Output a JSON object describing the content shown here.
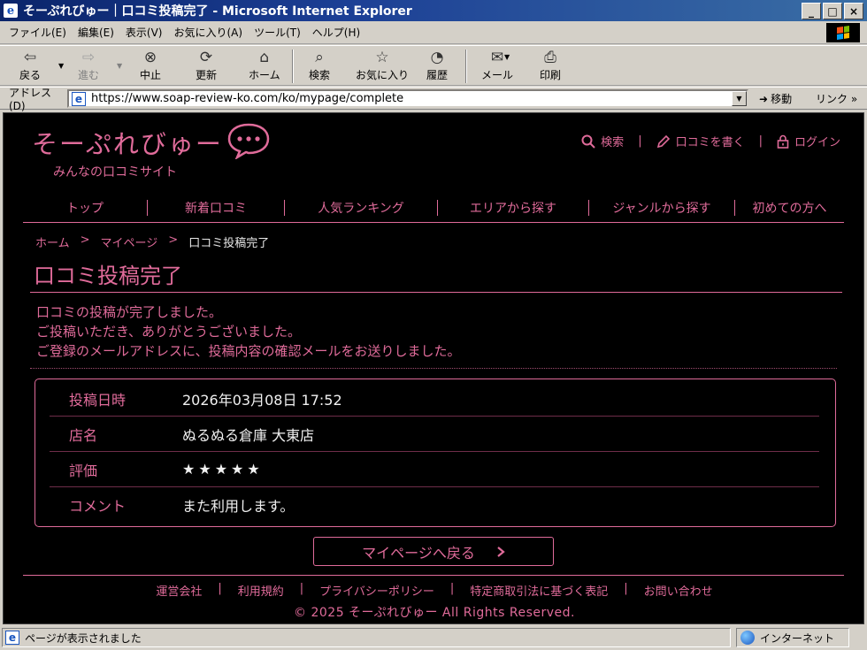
{
  "window": {
    "title": "そーぷれびゅー｜口コミ投稿完了 - Microsoft Internet Explorer",
    "buttons": [
      "_",
      "□",
      "×"
    ]
  },
  "menu": [
    "ファイル(E)",
    "編集(E)",
    "表示(V)",
    "お気に入り(A)",
    "ツール(T)",
    "ヘルプ(H)"
  ],
  "toolbar": {
    "back": "戻る",
    "forward": "進む",
    "stop": "中止",
    "refresh": "更新",
    "home": "ホーム",
    "search": "検索",
    "favorites": "お気に入り",
    "history": "履歴",
    "mail": "メール",
    "print": "印刷"
  },
  "address": {
    "label": "アドレス(D)",
    "url": "https://www.soap-review-ko.com/ko/mypage/complete",
    "go": "移動",
    "links": "リンク »"
  },
  "site": {
    "logo": "そーぷれびゅー",
    "tagline": "みんなの口コミサイト",
    "header_links": {
      "search": "検索",
      "write": "口コミを書く",
      "login": "ログイン"
    },
    "nav": [
      "トップ",
      "新着口コミ",
      "人気ランキング",
      "エリアから探す",
      "ジャンルから探す",
      "初めての方へ"
    ],
    "breadcrumb": {
      "home": "ホーム",
      "sep": ">",
      "mypage": "マイページ",
      "current": "口コミ投稿完了"
    },
    "page_title": "口コミ投稿完了",
    "messages": [
      "口コミの投稿が完了しました。",
      "ご投稿いただき、ありがとうございました。",
      "ご登録のメールアドレスに、投稿内容の確認メールをお送りしました。"
    ],
    "details": {
      "date_label": "投稿日時",
      "date_value": "2026年03月08日 17:52",
      "shop_label": "店名",
      "shop_value": "ぬるぬる倉庫 大東店",
      "rating_label": "評価",
      "rating_value": 5,
      "rating_stars": "★★★★★",
      "comment_label": "コメント",
      "comment_value": "また利用します。"
    },
    "back_button": "マイページへ戻る",
    "footer_links": [
      "運営会社",
      "利用規約",
      "プライバシーポリシー",
      "特定商取引法に基づく表記",
      "お問い合わせ"
    ],
    "copyright": "© 2025 そーぷれびゅー All Rights Reserved."
  },
  "status": {
    "text": "ページが表示されました",
    "zone": "インターネット"
  },
  "colors": {
    "accent": "#e06b9a",
    "page_bg": "#000000",
    "titlebar": "#0a246a"
  }
}
